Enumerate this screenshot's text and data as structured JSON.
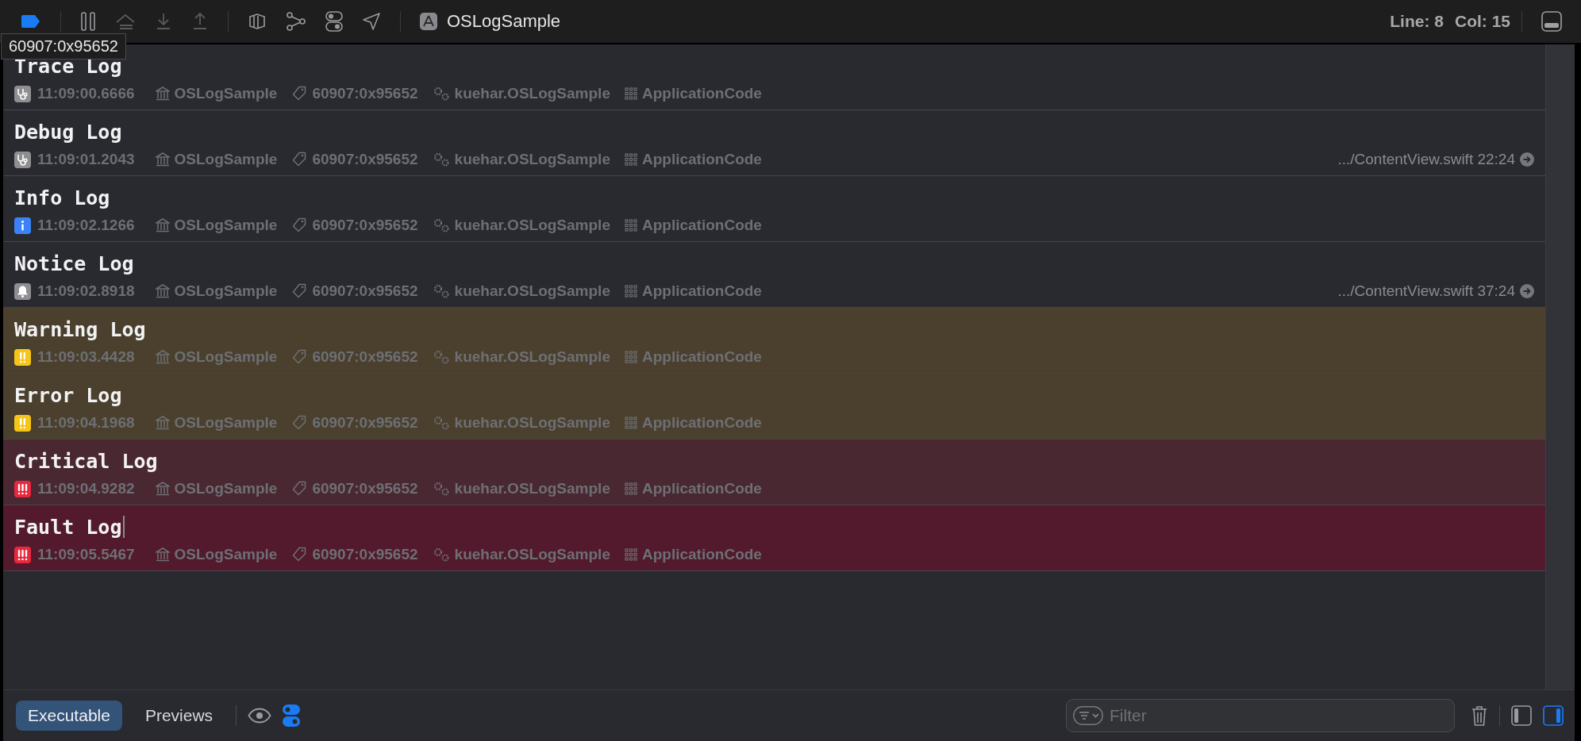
{
  "toolbar": {
    "scheme": "OSLogSample",
    "line": "Line: 8",
    "column": "Col: 15"
  },
  "tooltip": "60907:0x95652",
  "logs": [
    {
      "kind": "trace",
      "message": "Trace Log",
      "time": "11:09:00.6666",
      "process": "OSLogSample",
      "thread": "60907:0x95652",
      "subsystem": "kuehar.OSLogSample",
      "category": "ApplicationCode",
      "cursor": false
    },
    {
      "kind": "debug",
      "message": "Debug Log",
      "time": "11:09:01.2043",
      "process": "OSLogSample",
      "thread": "60907:0x95652",
      "subsystem": "kuehar.OSLogSample",
      "category": "ApplicationCode",
      "source": ".../ContentView.swift 22:24",
      "cursor": false
    },
    {
      "kind": "info",
      "message": "Info Log",
      "time": "11:09:02.1266",
      "process": "OSLogSample",
      "thread": "60907:0x95652",
      "subsystem": "kuehar.OSLogSample",
      "category": "ApplicationCode",
      "cursor": false
    },
    {
      "kind": "notice",
      "message": "Notice Log",
      "time": "11:09:02.8918",
      "process": "OSLogSample",
      "thread": "60907:0x95652",
      "subsystem": "kuehar.OSLogSample",
      "category": "ApplicationCode",
      "source": ".../ContentView.swift 37:24",
      "cursor": false
    },
    {
      "kind": "warning",
      "message": "Warning Log",
      "time": "11:09:03.4428",
      "process": "OSLogSample",
      "thread": "60907:0x95652",
      "subsystem": "kuehar.OSLogSample",
      "category": "ApplicationCode",
      "cursor": false
    },
    {
      "kind": "error",
      "message": "Error Log",
      "time": "11:09:04.1968",
      "process": "OSLogSample",
      "thread": "60907:0x95652",
      "subsystem": "kuehar.OSLogSample",
      "category": "ApplicationCode",
      "cursor": false
    },
    {
      "kind": "critical",
      "message": "Critical Log",
      "time": "11:09:04.9282",
      "process": "OSLogSample",
      "thread": "60907:0x95652",
      "subsystem": "kuehar.OSLogSample",
      "category": "ApplicationCode",
      "cursor": false
    },
    {
      "kind": "fault",
      "message": "Fault Log",
      "time": "11:09:05.5467",
      "process": "OSLogSample",
      "thread": "60907:0x95652",
      "subsystem": "kuehar.OSLogSample",
      "category": "ApplicationCode",
      "cursor": true
    }
  ],
  "bottom": {
    "tabs": [
      {
        "label": "Executable",
        "selected": true
      },
      {
        "label": "Previews",
        "selected": false
      }
    ],
    "filter": {
      "placeholder": "Filter"
    }
  }
}
